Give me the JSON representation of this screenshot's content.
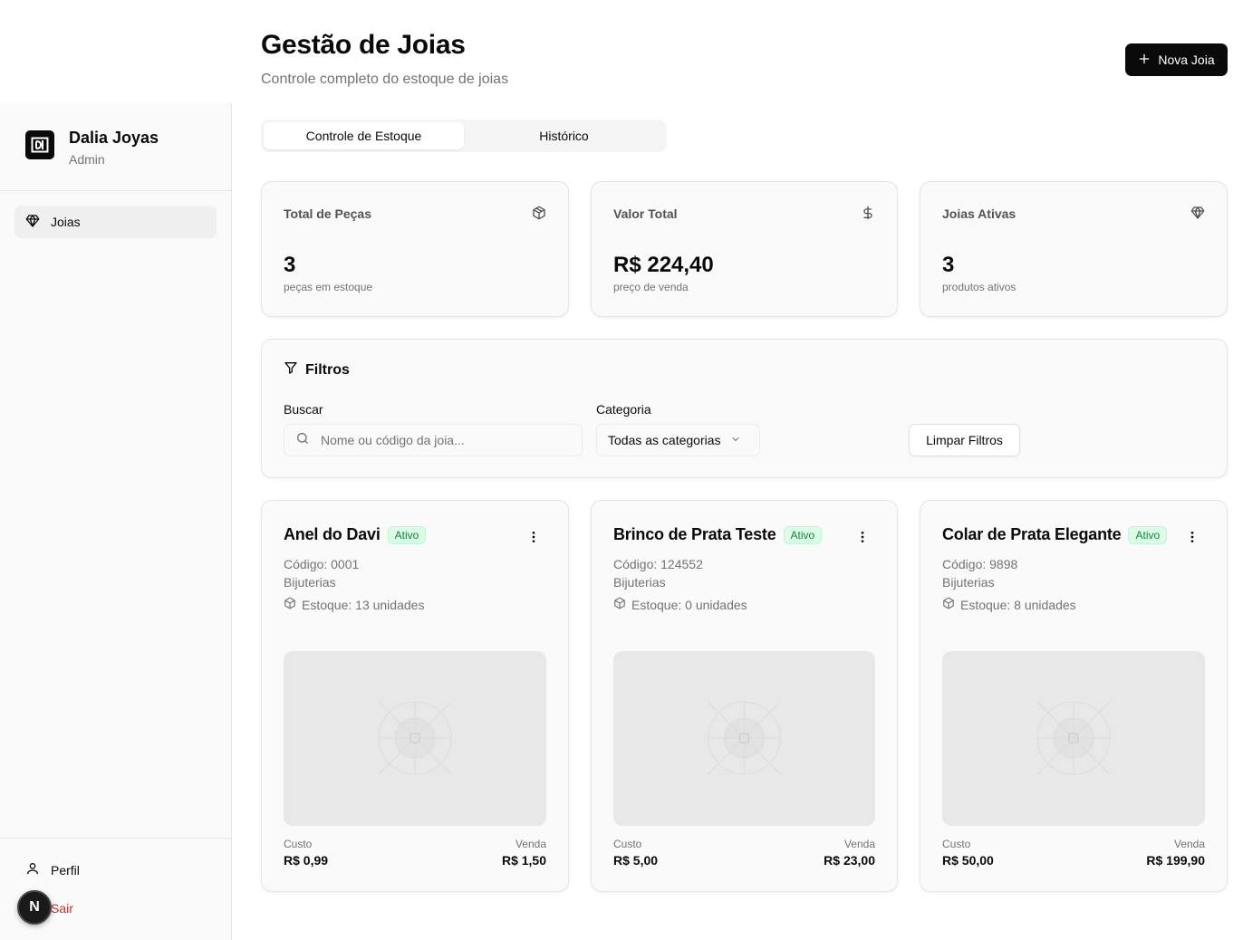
{
  "sidebar": {
    "brand_name": "Dalia Joyas",
    "brand_role": "Admin",
    "nav": [
      {
        "label": "Joias",
        "icon": "gem-icon"
      }
    ],
    "footer": {
      "profile": "Perfil",
      "logout": "Sair",
      "avatar_letter": "N"
    }
  },
  "header": {
    "title": "Gestão de Joias",
    "subtitle": "Controle completo do estoque de joias",
    "new_button": "Nova Joia"
  },
  "tabs": [
    {
      "label": "Controle de Estoque",
      "active": true
    },
    {
      "label": "Histórico",
      "active": false
    }
  ],
  "stats": [
    {
      "label": "Total de Peças",
      "value": "3",
      "sub": "peças em estoque",
      "icon": "package-icon"
    },
    {
      "label": "Valor Total",
      "value": "R$ 224,40",
      "sub": "preço de venda",
      "icon": "dollar-icon"
    },
    {
      "label": "Joias Ativas",
      "value": "3",
      "sub": "produtos ativos",
      "icon": "gem-icon"
    }
  ],
  "filters": {
    "title": "Filtros",
    "search_label": "Buscar",
    "search_placeholder": "Nome ou código da joia...",
    "category_label": "Categoria",
    "category_value": "Todas as categorias",
    "clear_button": "Limpar Filtros"
  },
  "products": [
    {
      "name": "Anel do Davi",
      "status": "Ativo",
      "code": "Código: 0001",
      "category": "Bijuterias",
      "stock": "Estoque: 13 unidades",
      "cost_label": "Custo",
      "cost": "R$ 0,99",
      "sale_label": "Venda",
      "sale": "R$ 1,50"
    },
    {
      "name": "Brinco de Prata Teste",
      "status": "Ativo",
      "code": "Código: 124552",
      "category": "Bijuterias",
      "stock": "Estoque: 0 unidades",
      "cost_label": "Custo",
      "cost": "R$ 5,00",
      "sale_label": "Venda",
      "sale": "R$ 23,00"
    },
    {
      "name": "Colar de Prata Elegante",
      "status": "Ativo",
      "code": "Código: 9898",
      "category": "Bijuterias",
      "stock": "Estoque: 8 unidades",
      "cost_label": "Custo",
      "cost": "R$ 50,00",
      "sale_label": "Venda",
      "sale": "R$ 199,90"
    }
  ]
}
